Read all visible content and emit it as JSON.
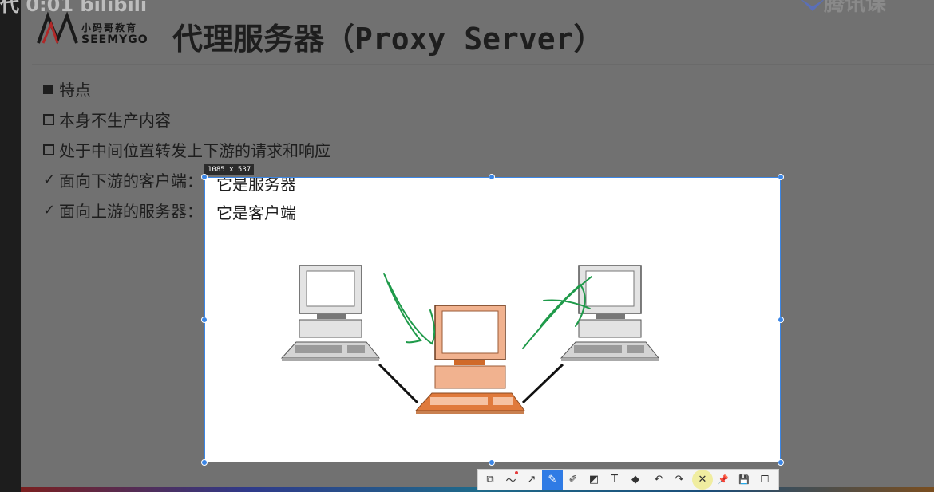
{
  "watermark": {
    "left_text": "代 0:01 bilibili",
    "right_text": "腾讯课"
  },
  "logo": {
    "cn": "小码哥教育",
    "en": "SEEMYGO"
  },
  "slide": {
    "title": "代理服务器（Proxy Server）",
    "bullets": [
      {
        "type": "filled-square",
        "text": "特点"
      },
      {
        "type": "hollow-square",
        "text": "本身不生产内容"
      },
      {
        "type": "hollow-square",
        "text": "处于中间位置转发上下游的请求和响应"
      },
      {
        "type": "check",
        "text": "面向下游的客户端："
      },
      {
        "type": "check",
        "text": "面向上游的服务器："
      }
    ]
  },
  "selection": {
    "size_label": "1085 x 537",
    "line1": "它是服务器",
    "line2": "它是客户端",
    "diagram": {
      "nodes": [
        "client-computer",
        "proxy-computer",
        "server-computer"
      ],
      "proxy_color": "#f1b28f",
      "annotation_color": "#1f9a4a"
    }
  },
  "toolbar": {
    "tools": [
      {
        "name": "rectangle-tool",
        "glyph": "⧉",
        "active": false
      },
      {
        "name": "curve-tool",
        "glyph": "〜",
        "active": false,
        "badge": true
      },
      {
        "name": "arrow-tool",
        "glyph": "↗",
        "active": false
      },
      {
        "name": "pen-tool",
        "glyph": "✎",
        "active": true
      },
      {
        "name": "marker-tool",
        "glyph": "✐",
        "active": false
      },
      {
        "name": "mosaic-tool",
        "glyph": "◩",
        "active": false
      },
      {
        "name": "text-tool",
        "glyph": "T",
        "active": false
      },
      {
        "name": "eraser-tool",
        "glyph": "◆",
        "active": false
      },
      {
        "name": "undo-tool",
        "glyph": "↶",
        "active": false
      },
      {
        "name": "redo-tool",
        "glyph": "↷",
        "active": false
      },
      {
        "name": "close-tool",
        "glyph": "✕",
        "active": false,
        "hover": true
      },
      {
        "name": "pin-tool",
        "glyph": "📌",
        "active": false
      },
      {
        "name": "save-tool",
        "glyph": "💾",
        "active": false
      },
      {
        "name": "copy-tool",
        "glyph": "⧠",
        "active": false
      }
    ]
  }
}
